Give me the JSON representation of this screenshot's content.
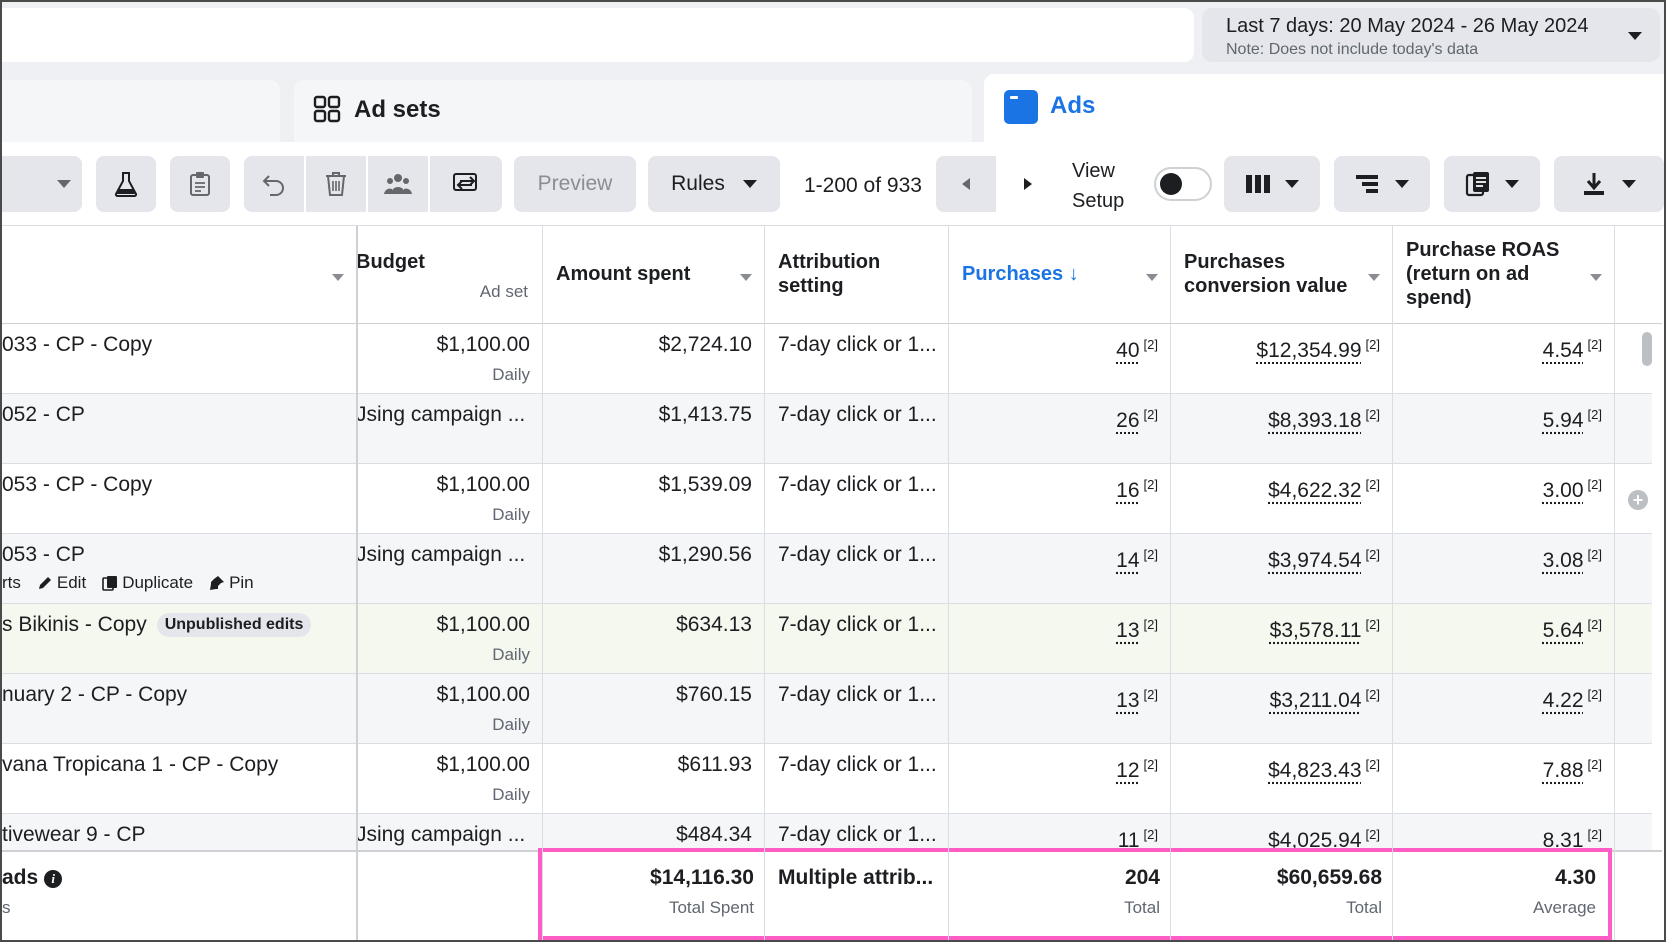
{
  "date_picker": {
    "range": "Last 7 days: 20 May 2024 - 26 May 2024",
    "note": "Note: Does not include today's data"
  },
  "tabs": {
    "adsets": "Ad sets",
    "ads": "Ads"
  },
  "toolbar": {
    "preview": "Preview",
    "rules": "Rules",
    "page_count": "1-200 of 933",
    "view_setup_line1": "View",
    "view_setup_line2": "Setup"
  },
  "columns": {
    "budget": "Budget",
    "budget_sub": "Ad set",
    "amount_spent": "Amount spent",
    "attribution": "Attribution setting",
    "purchases": "Purchases ↓",
    "conv_value": "Purchases conversion value",
    "roas": "Purchase ROAS (return on ad spend)"
  },
  "footnote": "[2]",
  "rows": [
    {
      "name": "033 - CP - Copy",
      "budget": "$1,100.00",
      "budget_sub": "Daily",
      "spent": "$2,724.10",
      "attribution": "7-day click or 1...",
      "purchases": "40",
      "value": "$12,354.99",
      "roas": "4.54"
    },
    {
      "name": "052 - CP",
      "budget": "Jsing campaign ...",
      "budget_sub": "",
      "spent": "$1,413.75",
      "attribution": "7-day click or 1...",
      "purchases": "26",
      "value": "$8,393.18",
      "roas": "5.94"
    },
    {
      "name": "053 - CP - Copy",
      "budget": "$1,100.00",
      "budget_sub": "Daily",
      "spent": "$1,539.09",
      "attribution": "7-day click or 1...",
      "purchases": "16",
      "value": "$4,622.32",
      "roas": "3.00"
    },
    {
      "name": "053 - CP",
      "budget": "Jsing campaign ...",
      "budget_sub": "",
      "spent": "$1,290.56",
      "attribution": "7-day click or 1...",
      "purchases": "14",
      "value": "$3,974.54",
      "roas": "3.08"
    },
    {
      "name": "s Bikinis - Copy",
      "badge": "Unpublished edits",
      "budget": "$1,100.00",
      "budget_sub": "Daily",
      "spent": "$634.13",
      "attribution": "7-day click or 1...",
      "purchases": "13",
      "value": "$3,578.11",
      "roas": "5.64"
    },
    {
      "name": "nuary 2 - CP - Copy",
      "budget": "$1,100.00",
      "budget_sub": "Daily",
      "spent": "$760.15",
      "attribution": "7-day click or 1...",
      "purchases": "13",
      "value": "$3,211.04",
      "roas": "4.22"
    },
    {
      "name": "vana Tropicana 1 - CP - Copy",
      "budget": "$1,100.00",
      "budget_sub": "Daily",
      "spent": "$611.93",
      "attribution": "7-day click or 1...",
      "purchases": "12",
      "value": "$4,823.43",
      "roas": "7.88"
    },
    {
      "name": "tivewear 9 - CP",
      "budget": "Jsing campaign ...",
      "budget_sub": "",
      "spent": "$484.34",
      "attribution": "7-day click or 1...",
      "purchases": "11",
      "value": "$4,025.94",
      "roas": "8.31"
    }
  ],
  "row_actions": {
    "charts": "rts",
    "edit": "Edit",
    "duplicate": "Duplicate",
    "pin": "Pin"
  },
  "totals": {
    "label": "ads",
    "label_sub": "s",
    "spent": "$14,116.30",
    "spent_label": "Total Spent",
    "attribution": "Multiple attrib...",
    "purchases": "204",
    "purchases_label": "Total",
    "value": "$60,659.68",
    "value_label": "Total",
    "roas": "4.30",
    "roas_label": "Average"
  },
  "colors": {
    "accent": "#1b74e4",
    "highlight": "#ff5cc6"
  }
}
